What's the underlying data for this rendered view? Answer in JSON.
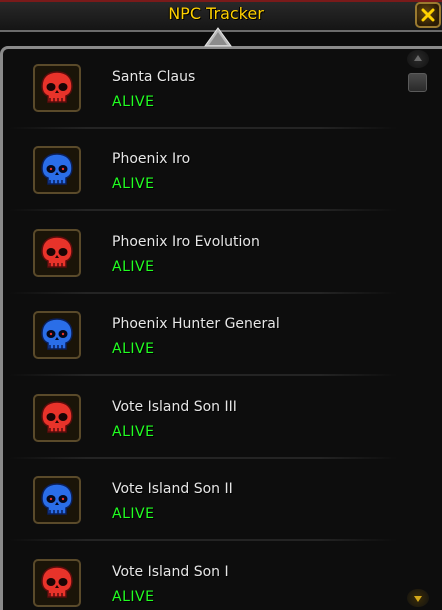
{
  "window": {
    "title": "NPC Tracker"
  },
  "colors": {
    "title": "#ffd100",
    "name": "#e6e6e6",
    "status_alive": "#22ff22",
    "skull_red": "#e8332a",
    "skull_blue": "#2a6ee8"
  },
  "npcs": [
    {
      "name": "Santa Claus",
      "status": "ALIVE",
      "icon": "red-skull-icon"
    },
    {
      "name": "Phoenix Iro",
      "status": "ALIVE",
      "icon": "blue-skull-icon"
    },
    {
      "name": "Phoenix Iro Evolution",
      "status": "ALIVE",
      "icon": "red-skull-icon"
    },
    {
      "name": "Phoenix Hunter General",
      "status": "ALIVE",
      "icon": "blue-skull-icon"
    },
    {
      "name": "Vote Island Son III",
      "status": "ALIVE",
      "icon": "red-skull-icon"
    },
    {
      "name": "Vote Island Son II",
      "status": "ALIVE",
      "icon": "blue-skull-icon"
    },
    {
      "name": "Vote Island Son I",
      "status": "ALIVE",
      "icon": "red-skull-icon"
    }
  ]
}
